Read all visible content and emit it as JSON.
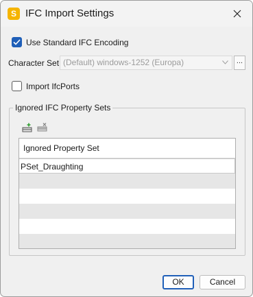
{
  "window": {
    "title": "IFC Import Settings",
    "app_icon_glyph": "S",
    "accent_color": "#1f5fb8",
    "app_icon_color": "#f5b400"
  },
  "options": {
    "use_standard_encoding": {
      "label": "Use Standard IFC Encoding",
      "checked": true
    },
    "import_ifcports": {
      "label": "Import IfcPorts",
      "checked": false
    }
  },
  "character_set": {
    "label": "Character Set",
    "value": "(Default) windows-1252 (Europa)",
    "disabled": true,
    "browse_label": "..."
  },
  "ignored_sets": {
    "group_label": "Ignored IFC Property Sets",
    "toolbar": {
      "add_icon": "add-row-icon",
      "delete_icon": "delete-row-icon"
    },
    "column_header": "Ignored Property Set",
    "rows": [
      "PSet_Draughting",
      "",
      "",
      "",
      "",
      ""
    ]
  },
  "buttons": {
    "ok": "OK",
    "cancel": "Cancel"
  }
}
